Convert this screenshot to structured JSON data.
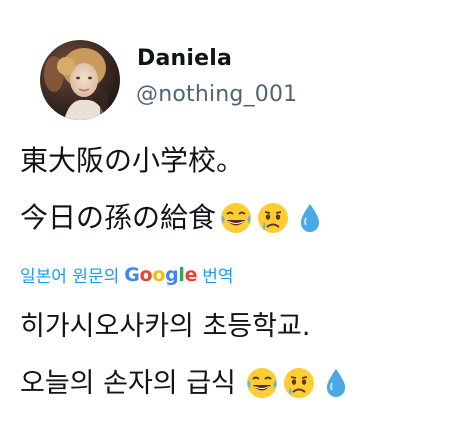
{
  "author": {
    "name": "Daniela",
    "handle": "@nothing_001"
  },
  "tweet": {
    "line1": "東大阪の小学校。",
    "line2": "今日の孫の給食",
    "line2_emojis": [
      "face-with-tears-of-joy-icon",
      "crying-face-icon",
      "droplet-icon"
    ]
  },
  "translation": {
    "prefix": "일본어 원문의",
    "brand": [
      "G",
      "o",
      "o",
      "g",
      "l",
      "e"
    ],
    "brand_colors": [
      "#4285f4",
      "#ea4335",
      "#fbbc05",
      "#4285f4",
      "#34a853",
      "#ea4335"
    ],
    "suffix": "번역",
    "line1": "히가시오사카의 초등학교.",
    "line2": "오늘의 손자의 급식",
    "line2_emojis": [
      "face-with-tears-of-joy-icon",
      "crying-face-icon",
      "droplet-icon"
    ]
  },
  "colors": {
    "link": "#1d9bf0",
    "handle": "#536471",
    "text": "#0f1419"
  }
}
